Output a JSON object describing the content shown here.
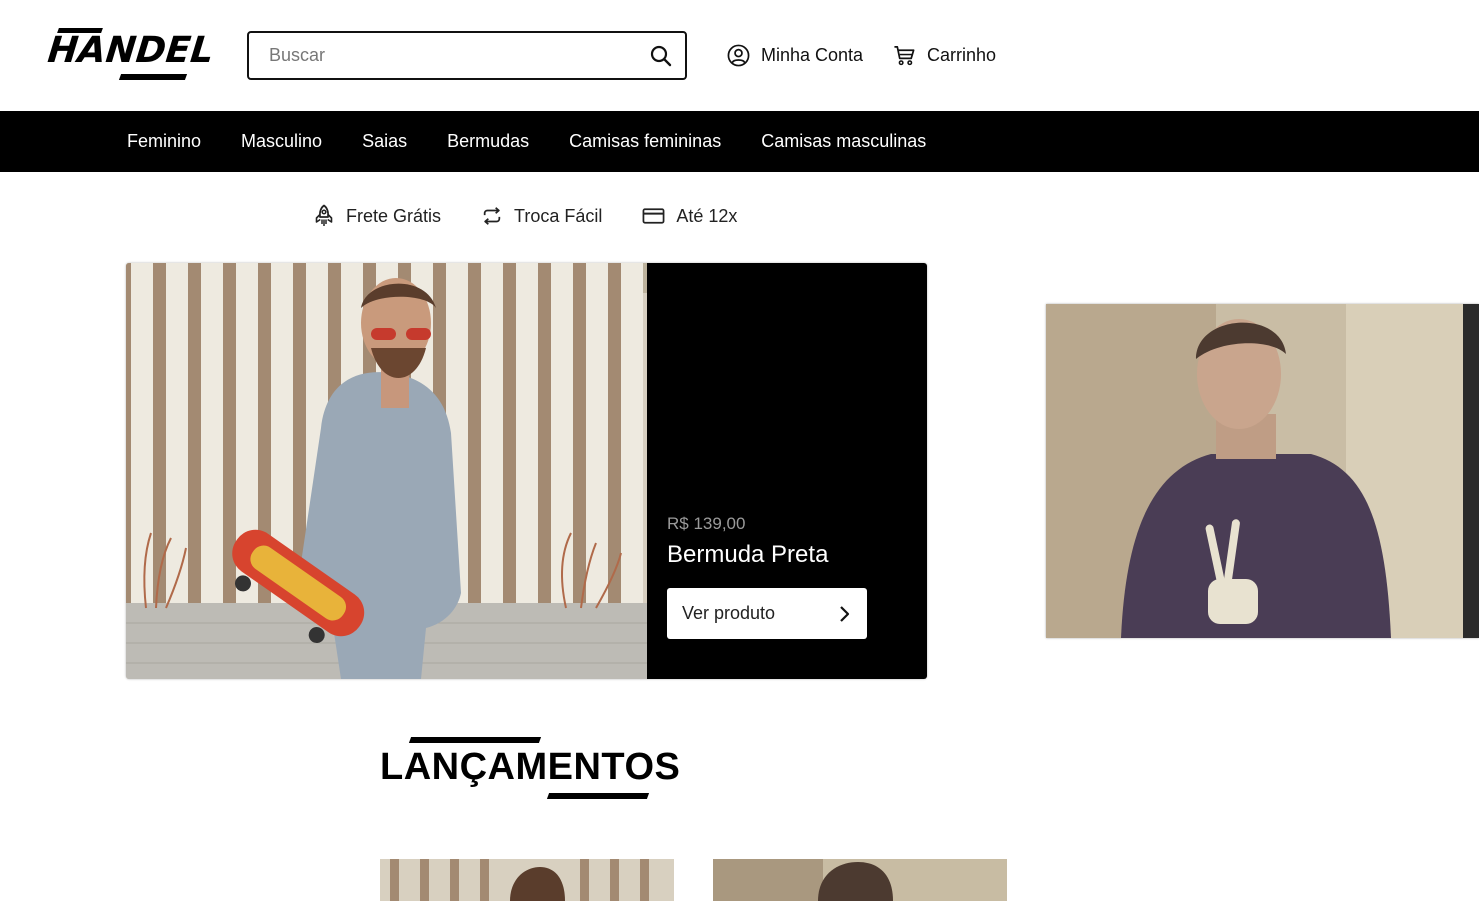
{
  "header": {
    "logo_text": "HANDEL",
    "search": {
      "placeholder": "Buscar",
      "value": ""
    },
    "account_label": "Minha Conta",
    "cart_label": "Carrinho"
  },
  "nav": {
    "items": [
      "Feminino",
      "Masculino",
      "Saias",
      "Bermudas",
      "Camisas femininas",
      "Camisas masculinas"
    ]
  },
  "benefits": [
    {
      "icon": "rocket-icon",
      "label": "Frete Grátis"
    },
    {
      "icon": "exchange-icon",
      "label": "Troca Fácil"
    },
    {
      "icon": "credit-card-icon",
      "label": "Até 12x"
    }
  ],
  "hero": {
    "price": "R$ 139,00",
    "product_name": "Bermuda Preta",
    "button_label": "Ver produto"
  },
  "section": {
    "title": "LANÇAMENTOS"
  },
  "colors": {
    "nav_bg": "#000000",
    "panel_bg": "#000000",
    "price_text": "#9a9a9a"
  }
}
